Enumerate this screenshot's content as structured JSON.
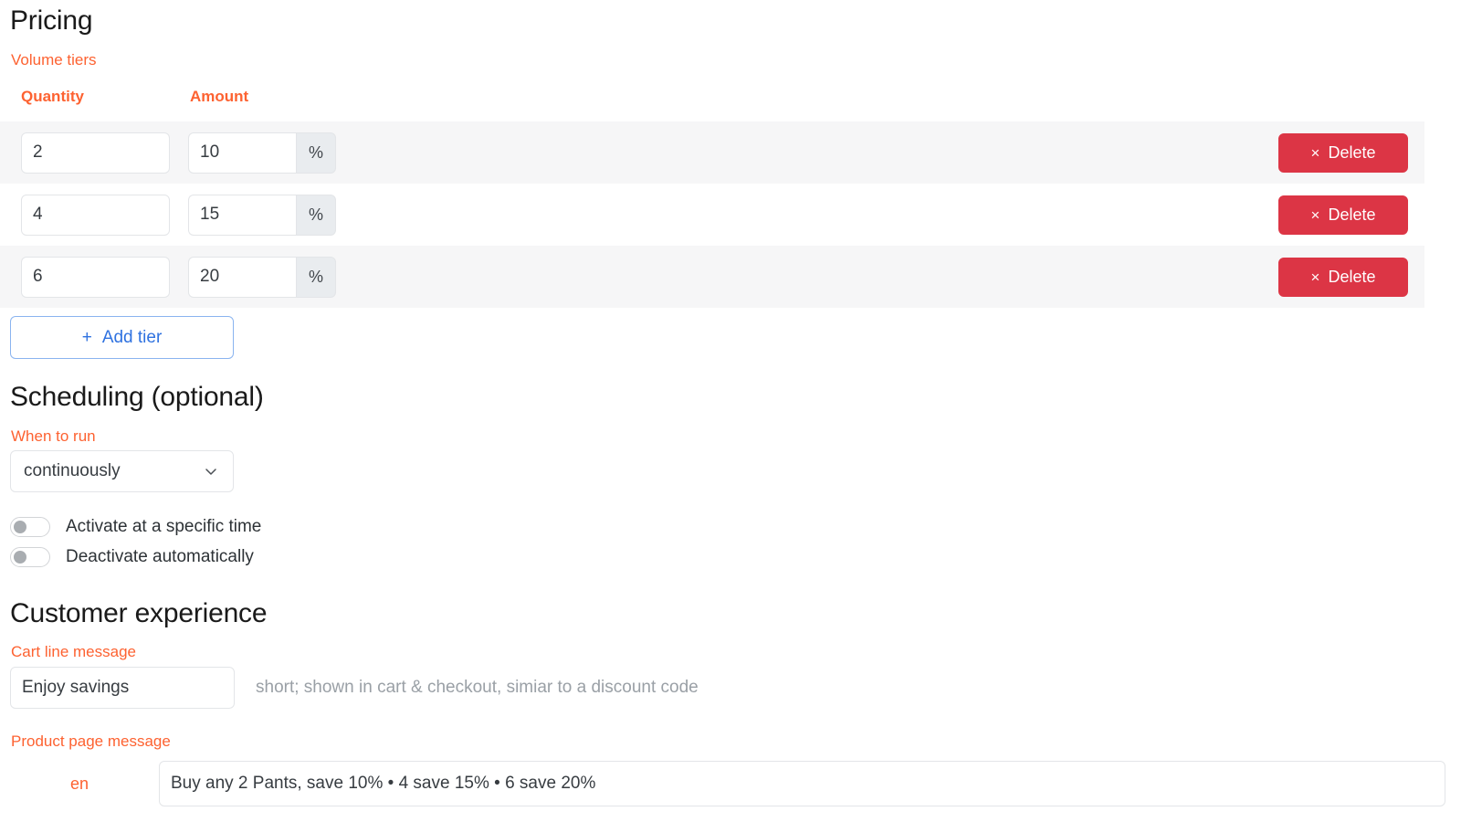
{
  "pricing": {
    "title": "Pricing",
    "volume_tiers_label": "Volume tiers",
    "columns": {
      "quantity": "Quantity",
      "amount": "Amount"
    },
    "tiers": [
      {
        "quantity": "2",
        "amount": "10",
        "unit": "%",
        "delete_label": "Delete",
        "delete_icon": "×"
      },
      {
        "quantity": "4",
        "amount": "15",
        "unit": "%",
        "delete_label": "Delete",
        "delete_icon": "×"
      },
      {
        "quantity": "6",
        "amount": "20",
        "unit": "%",
        "delete_label": "Delete",
        "delete_icon": "×"
      }
    ],
    "add_tier": {
      "plus": "+",
      "label": "Add tier"
    }
  },
  "scheduling": {
    "title": "Scheduling (optional)",
    "when_to_run_label": "When to run",
    "when_to_run_value": "continuously",
    "toggles": [
      {
        "label": "Activate at a specific time",
        "on": false
      },
      {
        "label": "Deactivate automatically",
        "on": false
      }
    ]
  },
  "customer_experience": {
    "title": "Customer experience",
    "cart_line_message_label": "Cart line message",
    "cart_line_message_value": "Enjoy savings",
    "cart_line_message_hint": "short; shown in cart & checkout, simiar to a discount code",
    "product_page_message_label": "Product page message",
    "product_page_locale": "en",
    "product_page_message_value": "Buy any 2 Pants, save 10% • 4 save 15% • 6 save 20%"
  },
  "colors": {
    "accent_orange": "#fd6231",
    "danger_red": "#dc3545",
    "link_blue": "#2f72e0",
    "stripe_gray": "#f6f6f7"
  }
}
